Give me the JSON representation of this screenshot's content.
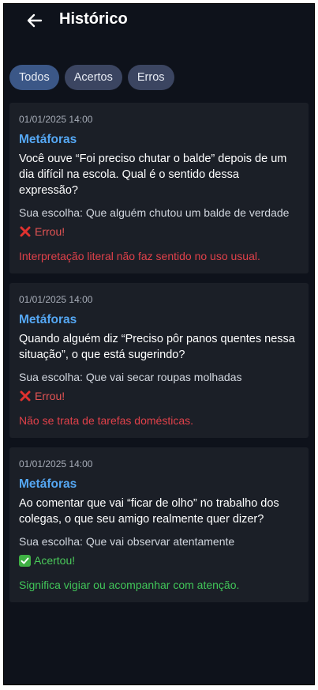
{
  "header": {
    "title": "Histórico",
    "back_icon": "arrow-left-icon"
  },
  "filters": [
    {
      "label": "Todos",
      "active": true
    },
    {
      "label": "Acertos",
      "active": false
    },
    {
      "label": "Erros",
      "active": false
    }
  ],
  "entries": [
    {
      "date": "01/01/2025 14:00",
      "topic": "Metáforas",
      "question": "Você ouve “Foi preciso chutar o balde” depois de um dia difícil na escola. Qual é o sentido dessa expressão?",
      "choice": "Sua escolha: Que alguém chutou um balde de verdade",
      "result": "Errou!",
      "correct": false,
      "explanation": "Interpretação literal não faz sentido no uso usual."
    },
    {
      "date": "01/01/2025 14:00",
      "topic": "Metáforas",
      "question": "Quando alguém diz “Preciso pôr panos quentes nessa situação”, o que está sugerindo?",
      "choice": "Sua escolha: Que vai secar roupas molhadas",
      "result": "Errou!",
      "correct": false,
      "explanation": "Não se trata de tarefas domésticas."
    },
    {
      "date": "01/01/2025 14:00",
      "topic": "Metáforas",
      "question": "Ao comentar que vai “ficar de olho” no trabalho dos colegas, o que seu amigo realmente quer dizer?",
      "choice": "Sua escolha: Que vai observar atentamente",
      "result": "Acertou!",
      "correct": true,
      "explanation": "Significa vigiar ou acompanhar com atenção."
    }
  ],
  "colors": {
    "background": "#0e121b",
    "card": "#1b1f27",
    "topic": "#55a7f3",
    "error": "#e45454",
    "success": "#4ac85a",
    "chip_active": "#3b5787",
    "chip": "#3b4561"
  }
}
